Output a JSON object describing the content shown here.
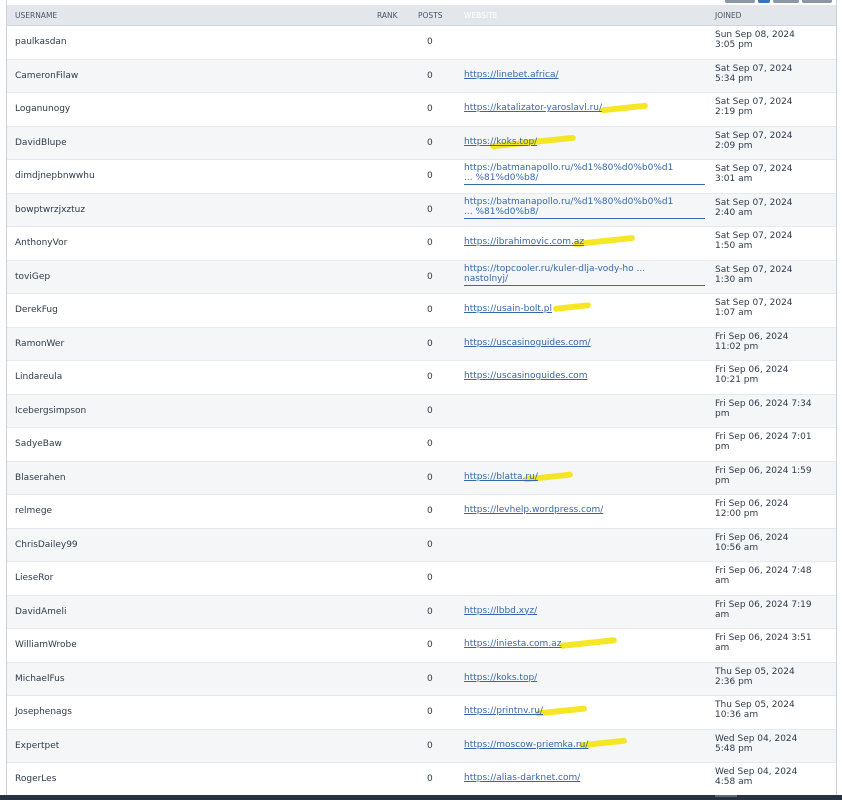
{
  "columns": {
    "username": "USERNAME",
    "rank": "RANK",
    "posts": "POSTS",
    "website": "WEBSITE",
    "joined": "JOINED"
  },
  "rows": [
    {
      "username": "paulkasdan",
      "posts": "0",
      "website": "",
      "joined_1": "Sun Sep 08, 2024",
      "joined_2": "3:05 pm"
    },
    {
      "username": "CameronFilaw",
      "posts": "0",
      "website": "https://linebet.africa/",
      "joined_1": "Sat Sep 07, 2024",
      "joined_2": "5:34 pm"
    },
    {
      "username": "Loganunogy",
      "posts": "0",
      "website": "https://katalizator-yaroslavl.ru/",
      "joined_1": "Sat Sep 07, 2024",
      "joined_2": "2:19 pm"
    },
    {
      "username": "DavidBlupe",
      "posts": "0",
      "website": "https://koks.top/",
      "joined_1": "Sat Sep 07, 2024",
      "joined_2": "2:09 pm"
    },
    {
      "username": "dimdjnepbnwwhu",
      "posts": "0",
      "website_1": "https://batmanapollo.ru/%d1%80%d0%b0%d1",
      "website_2": "... %81%d0%b8/",
      "joined_1": "Sat Sep 07, 2024",
      "joined_2": "3:01 am"
    },
    {
      "username": "bowptwrzjxztuz",
      "posts": "0",
      "website_1": "https://batmanapollo.ru/%d1%80%d0%b0%d1",
      "website_2": "... %81%d0%b8/",
      "joined_1": "Sat Sep 07, 2024",
      "joined_2": "2:40 am"
    },
    {
      "username": "AnthonyVor",
      "posts": "0",
      "website": "https://ibrahimovic.com.az",
      "joined_1": "Sat Sep 07, 2024",
      "joined_2": "1:50 am"
    },
    {
      "username": "toviGep",
      "posts": "0",
      "website_1": "https://topcooler.ru/kuler-dlja-vody-ho ...",
      "website_2": "nastolnyj/",
      "joined_1": "Sat Sep 07, 2024",
      "joined_2": "1:30 am"
    },
    {
      "username": "DerekFug",
      "posts": "0",
      "website": "https://usain-bolt.pl",
      "joined_1": "Sat Sep 07, 2024",
      "joined_2": "1:07 am"
    },
    {
      "username": "RamonWer",
      "posts": "0",
      "website": "https://uscasinoguides.com/",
      "joined_1": "Fri Sep 06, 2024",
      "joined_2": "11:02 pm"
    },
    {
      "username": "Lindareula",
      "posts": "0",
      "website": "https://uscasinoguides.com",
      "joined_1": "Fri Sep 06, 2024",
      "joined_2": "10:21 pm"
    },
    {
      "username": "Icebergsimpson",
      "posts": "0",
      "website": "",
      "joined_1": "Fri Sep 06, 2024 7:34",
      "joined_2": "pm"
    },
    {
      "username": "SadyeBaw",
      "posts": "0",
      "website": "",
      "joined_1": "Fri Sep 06, 2024 7:01",
      "joined_2": "pm"
    },
    {
      "username": "Blaserahen",
      "posts": "0",
      "website": "https://blatta.ru/",
      "joined_1": "Fri Sep 06, 2024 1:59",
      "joined_2": "pm"
    },
    {
      "username": "relmege",
      "posts": "0",
      "website": "https://levhelp.wordpress.com/",
      "joined_1": "Fri Sep 06, 2024",
      "joined_2": "12:00 pm"
    },
    {
      "username": "ChrisDailey99",
      "posts": "0",
      "website": "",
      "joined_1": "Fri Sep 06, 2024",
      "joined_2": "10:56 am"
    },
    {
      "username": "LieseRor",
      "posts": "0",
      "website": "",
      "joined_1": "Fri Sep 06, 2024 7:48",
      "joined_2": "am"
    },
    {
      "username": "DavidAmeli",
      "posts": "0",
      "website": "https://lbbd.xyz/",
      "joined_1": "Fri Sep 06, 2024 7:19",
      "joined_2": "am"
    },
    {
      "username": "WilliamWrobe",
      "posts": "0",
      "website": "https://iniesta.com.az",
      "joined_1": "Fri Sep 06, 2024 3:51",
      "joined_2": "am"
    },
    {
      "username": "MichaelFus",
      "posts": "0",
      "website": "https://koks.top/",
      "joined_1": "Thu Sep 05, 2024",
      "joined_2": "2:36 pm"
    },
    {
      "username": "Josephenags",
      "posts": "0",
      "website": "https://printnv.ru/",
      "joined_1": "Thu Sep 05, 2024",
      "joined_2": "10:36 am"
    },
    {
      "username": "Expertpet",
      "posts": "0",
      "website": "https://moscow-priemka.ru/",
      "joined_1": "Wed Sep 04, 2024",
      "joined_2": "5:48 pm"
    },
    {
      "username": "RogerLes",
      "posts": "0",
      "website": "https://alias-darknet.com/",
      "joined_1": "Wed Sep 04, 2024",
      "joined_2": "4:58 am"
    }
  ]
}
